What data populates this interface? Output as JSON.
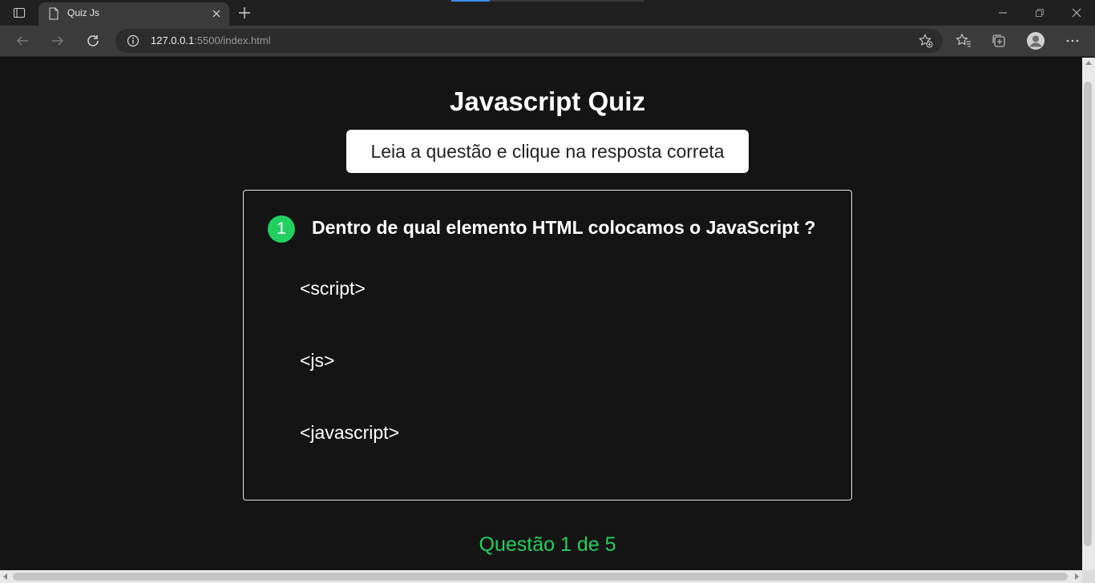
{
  "browser": {
    "tab_title": "Quiz Js",
    "url_host": "127.0.0.1",
    "url_path": ":5500/index.html"
  },
  "page": {
    "title": "Javascript Quiz",
    "instruction": "Leia a questão e clique na resposta correta",
    "question": {
      "number": "1",
      "text": "Dentro de qual elemento HTML colocamos o JavaScript ?",
      "options": [
        "<script>",
        "<js>",
        "<javascript>"
      ]
    },
    "progress": "Questão 1 de 5"
  },
  "colors": {
    "accent": "#21d05e",
    "background": "#141414"
  }
}
